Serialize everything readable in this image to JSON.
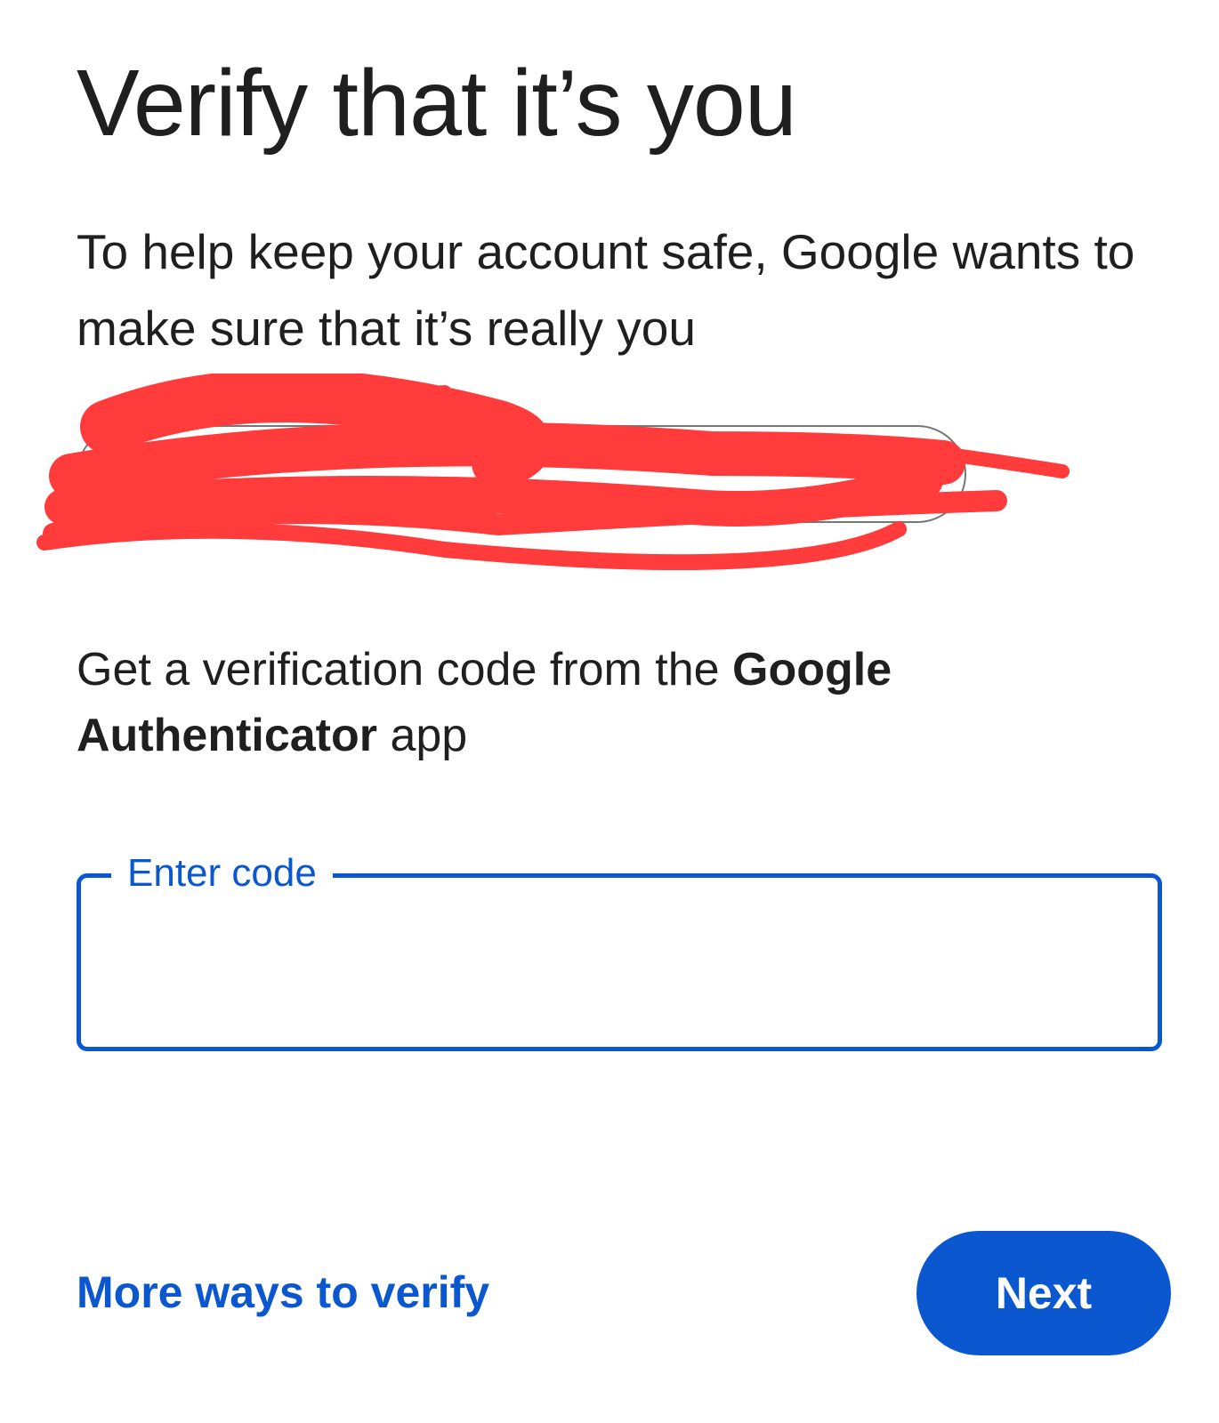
{
  "header": {
    "title": "Verify that it’s you",
    "subtitle": "To help keep your account safe, Google wants to make sure that it’s really you"
  },
  "account_chip": {
    "redacted": true
  },
  "instruction": {
    "prefix": "Get a verification code from the ",
    "app_name": "Google Authenticator",
    "suffix": " app"
  },
  "code_field": {
    "label": "Enter code",
    "value": ""
  },
  "actions": {
    "more_ways_label": "More ways to verify",
    "next_label": "Next"
  },
  "colors": {
    "accent": "#0b57d0",
    "text": "#1f1f1f",
    "redaction": "#ff3b3b"
  }
}
